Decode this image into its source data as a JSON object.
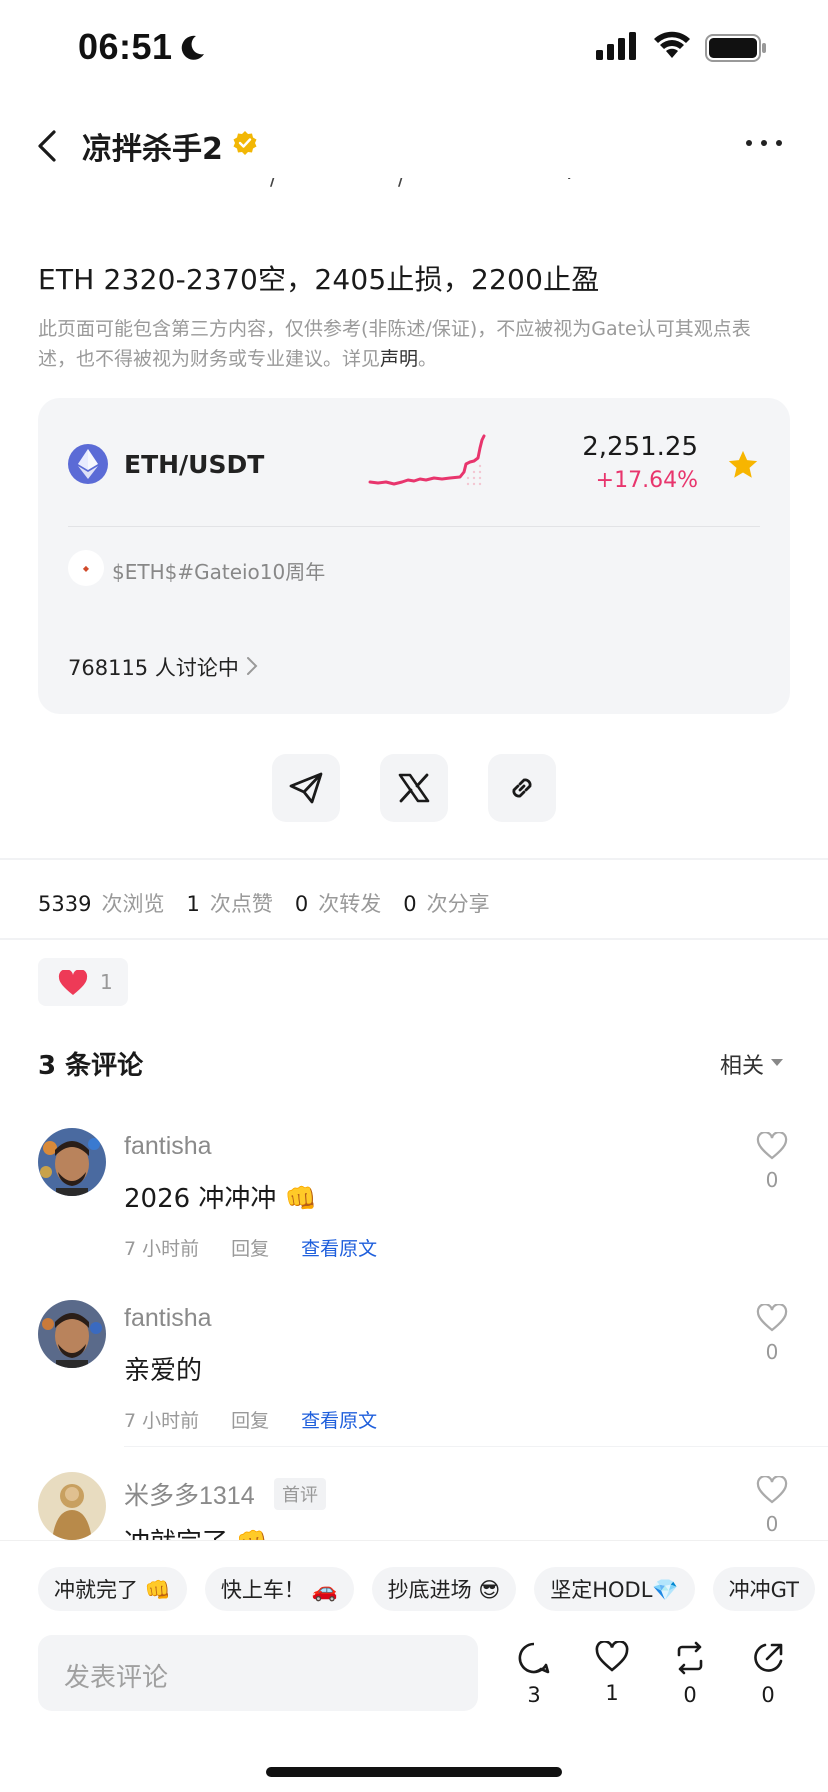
{
  "status_bar": {
    "time": "06:51"
  },
  "header": {
    "title": "凉拌杀手2"
  },
  "post": {
    "text": "ETH 2320-2370空，2405止损，2200止盈",
    "disclaimer_main": "此页面可能包含第三方内容，仅供参考(非陈述/保证)，不应被视为Gate认可其观点表述，也不得被视为财务或专业建议。详见",
    "disclaimer_link": "声明",
    "disclaimer_end": "。"
  },
  "market_card": {
    "pair": "ETH/USDT",
    "price": "2,251.25",
    "change": "+17.64%",
    "tag": "$ETH$#Gateio10周年",
    "discussing": "768115 人讨论中"
  },
  "stats": [
    {
      "value": "5339",
      "label": "次浏览"
    },
    {
      "value": "1",
      "label": "次点赞"
    },
    {
      "value": "0",
      "label": "次转发"
    },
    {
      "value": "0",
      "label": "次分享"
    }
  ],
  "like_chip": {
    "count": "1"
  },
  "comments_section": {
    "title": "3 条评论",
    "sort": "相关"
  },
  "comments": [
    {
      "user": "fantisha",
      "text": "2026 冲冲冲 👊",
      "time": "7 小时前",
      "reply": "回复",
      "view_original": "查看原文",
      "likes": "0"
    },
    {
      "user": "fantisha",
      "text": "亲爱的",
      "time": "7 小时前",
      "reply": "回复",
      "view_original": "查看原文",
      "likes": "0"
    },
    {
      "user": "米多多1314",
      "badge": "首评",
      "text": "冲就完了 👊",
      "likes": "0"
    }
  ],
  "quick_replies": [
    "冲就完了 👊",
    "快上车！ 🚗",
    "抄底进场 😎",
    "坚定HODL💎",
    "冲冲GT"
  ],
  "comment_input": {
    "placeholder": "发表评论"
  },
  "actions": [
    {
      "icon": "comment-icon",
      "count": "3"
    },
    {
      "icon": "like-icon",
      "count": "1"
    },
    {
      "icon": "repost-icon",
      "count": "0"
    },
    {
      "icon": "share-icon",
      "count": "0"
    }
  ],
  "colors": {
    "accent_red": "#e8356d",
    "link_blue": "#1f5fdc",
    "star_gold": "#f7b500",
    "eth_purple": "#5b6bd6"
  }
}
